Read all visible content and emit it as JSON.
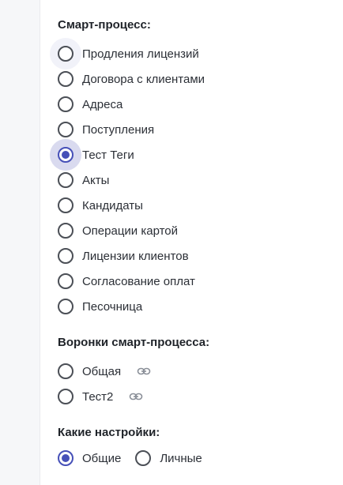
{
  "smart_process": {
    "title": "Смарт-процесс:",
    "options": [
      "Продления лицензий",
      "Договора с клиентами",
      "Адреса",
      "Поступления",
      "Тест Теги",
      "Акты",
      "Кандидаты",
      "Операции картой",
      "Лицензии клиентов",
      "Согласование оплат",
      "Песочница"
    ],
    "selected": "Тест Теги"
  },
  "funnels": {
    "title": "Воронки смарт-процесса:",
    "options": [
      "Общая",
      "Тест2"
    ],
    "link_icon": "link-icon"
  },
  "settings": {
    "title": "Какие настройки:",
    "options": [
      "Общие",
      "Личные"
    ],
    "selected": "Общие"
  },
  "colors": {
    "accent": "#4650b8",
    "ring": "#4b4f56",
    "sidebar_bg": "#f6f7f9"
  }
}
